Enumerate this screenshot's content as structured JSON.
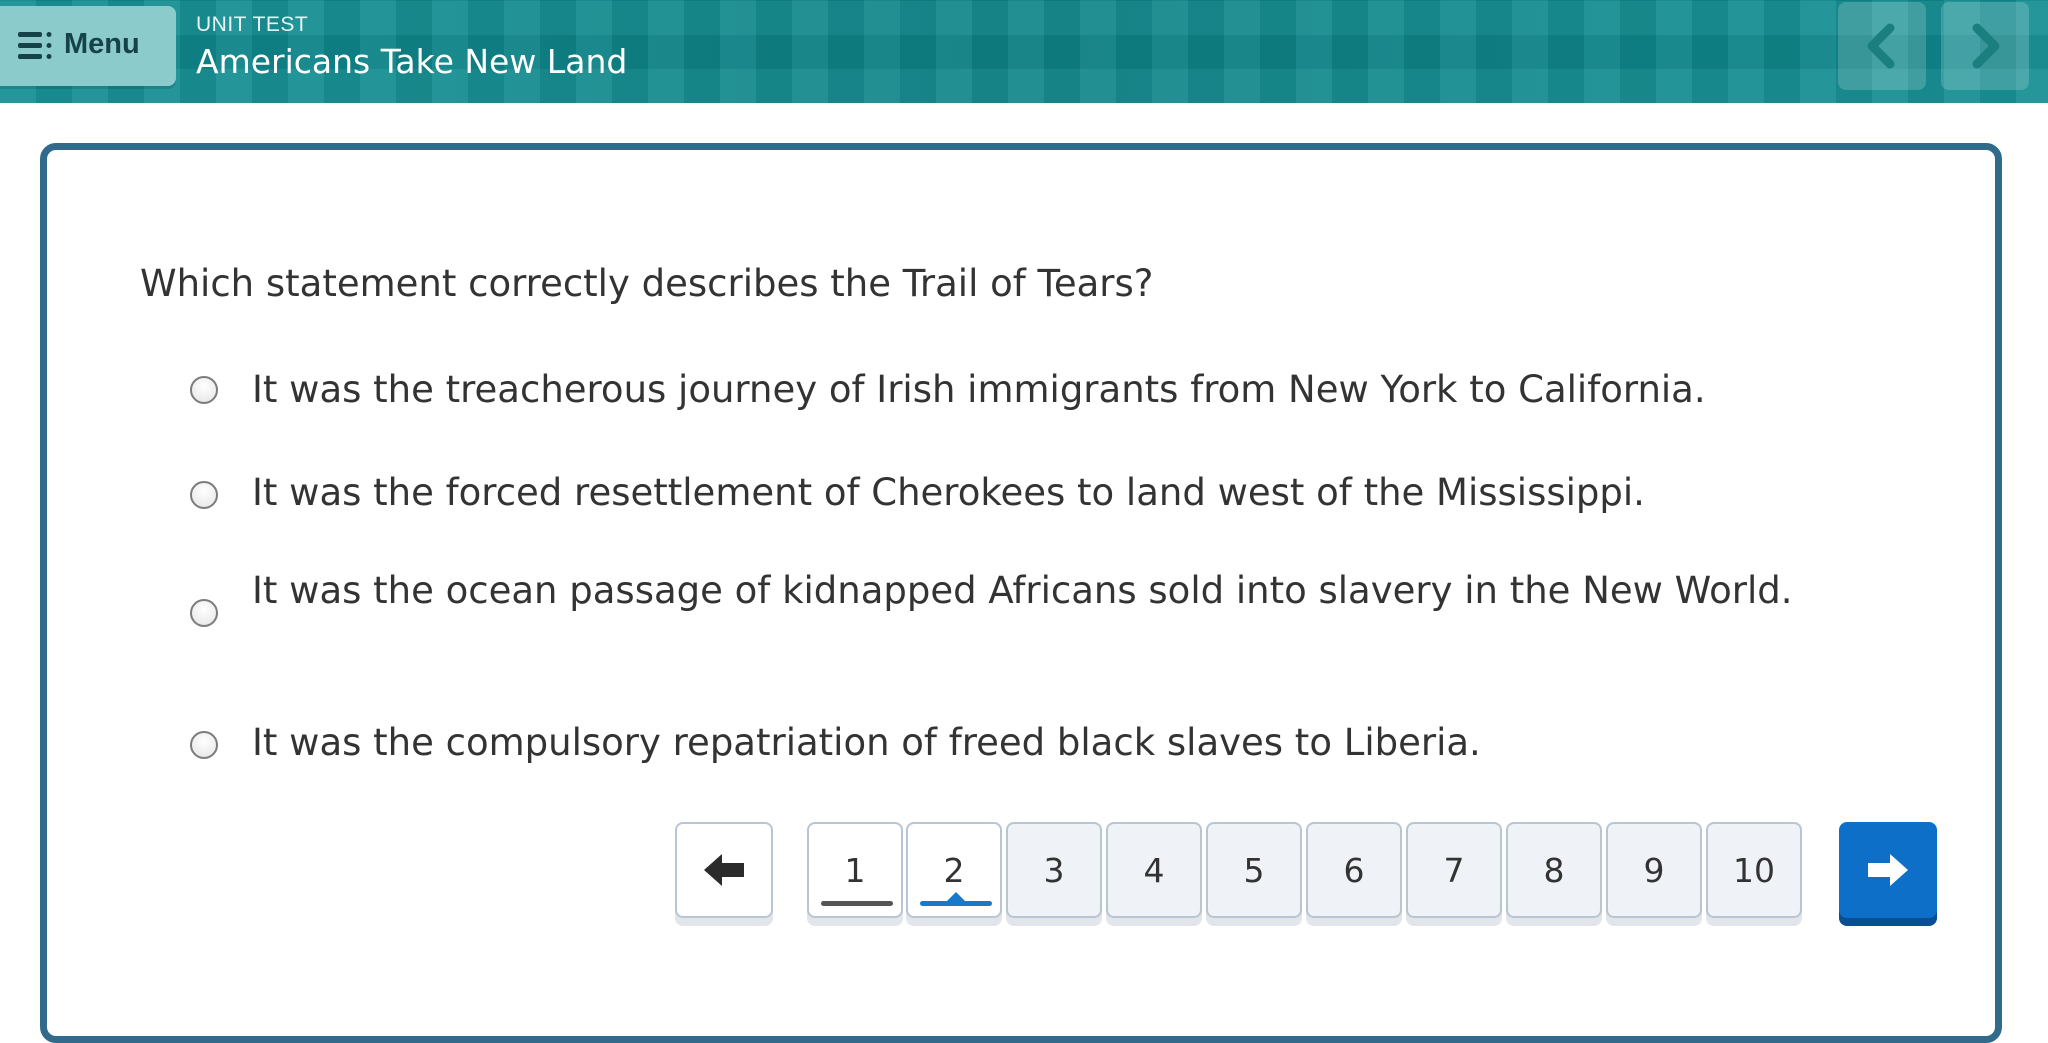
{
  "header": {
    "menu_label": "Menu",
    "unit_label": "UNIT TEST",
    "title": "Americans Take New Land",
    "icons": {
      "menu": "menu-list-icon",
      "prev": "chevron-left-icon",
      "next": "chevron-right-icon"
    },
    "colors": {
      "bar": "#0f8d91",
      "menu_button": "#8ccbcb"
    }
  },
  "question": {
    "text": "Which statement correctly describes the Trail of Tears?",
    "options": [
      {
        "text": "It was the treacherous journey of Irish immigrants from New York to California.",
        "selected": false
      },
      {
        "text": "It was the forced resettlement of Cherokees to land west of the Mississippi.",
        "selected": false
      },
      {
        "text": "It was the ocean passage of kidnapped Africans sold into slavery in the New World.",
        "selected": false
      },
      {
        "text": "It was the compulsory repatriation of freed black slaves to Liberia.",
        "selected": false
      }
    ]
  },
  "pagination": {
    "pages": [
      "1",
      "2",
      "3",
      "4",
      "5",
      "6",
      "7",
      "8",
      "9",
      "10"
    ],
    "current_page": 2,
    "answered_pages": [
      1
    ],
    "prev_icon": "arrow-left-icon",
    "next_icon": "arrow-right-icon",
    "colors": {
      "next_button": "#0d6fc7",
      "current_indicator": "#1679cc",
      "answered_indicator": "#555555",
      "card_border": "#316a8b"
    }
  }
}
